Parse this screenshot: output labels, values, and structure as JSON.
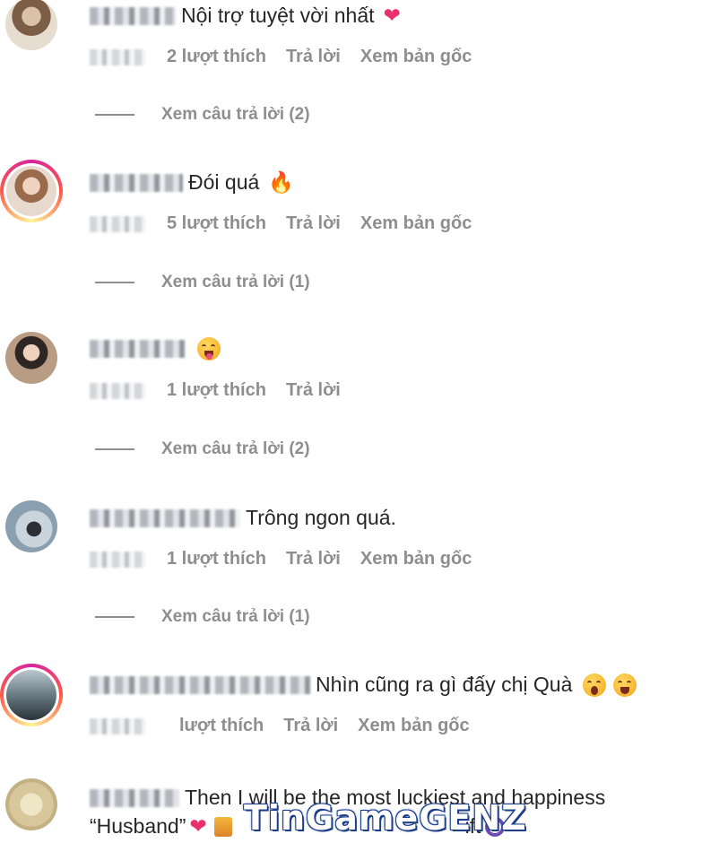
{
  "comments": [
    {
      "text": "Nội trợ tuyệt vời nhất",
      "emoji": "heart-emoji",
      "likes": "2 lượt thích",
      "reply": "Trả lời",
      "see_original": "Xem bản gốc",
      "view_replies": "Xem câu trả lời (2)",
      "avatar_ring": false
    },
    {
      "text": "Đói quá",
      "emoji": "fire-emoji",
      "likes": "5 lượt thích",
      "reply": "Trả lời",
      "see_original": "Xem bản gốc",
      "view_replies": "Xem câu trả lời (1)",
      "avatar_ring": true
    },
    {
      "text": "",
      "emoji": "tongue-face-emoji",
      "likes": "1 lượt thích",
      "reply": "Trả lời",
      "view_replies": "Xem câu trả lời (2)",
      "avatar_ring": false
    },
    {
      "text": "Trông ngon quá.",
      "likes": "1 lượt thích",
      "reply": "Trả lời",
      "see_original": "Xem bản gốc",
      "view_replies": "Xem câu trả lời (1)",
      "avatar_ring": false
    },
    {
      "text": "Nhìn cũng ra gì đấy chị Quà",
      "emoji": "astonished-face-emoji, grinning-face-emoji",
      "likes": "lượt thích",
      "reply": "Trả lời",
      "see_original": "Xem bản gốc",
      "avatar_ring": true
    },
    {
      "text": "Then I will be the most luckiest and happiness",
      "text2": "“Husband”",
      "text2_tail": "ift",
      "avatar_ring": false
    }
  ],
  "watermark": "TinGameGENZ",
  "colors": {
    "meta_text": "#8e8e8e",
    "body_text": "#262626",
    "heart": "#e8316a",
    "story_ring": "#d6249f"
  }
}
